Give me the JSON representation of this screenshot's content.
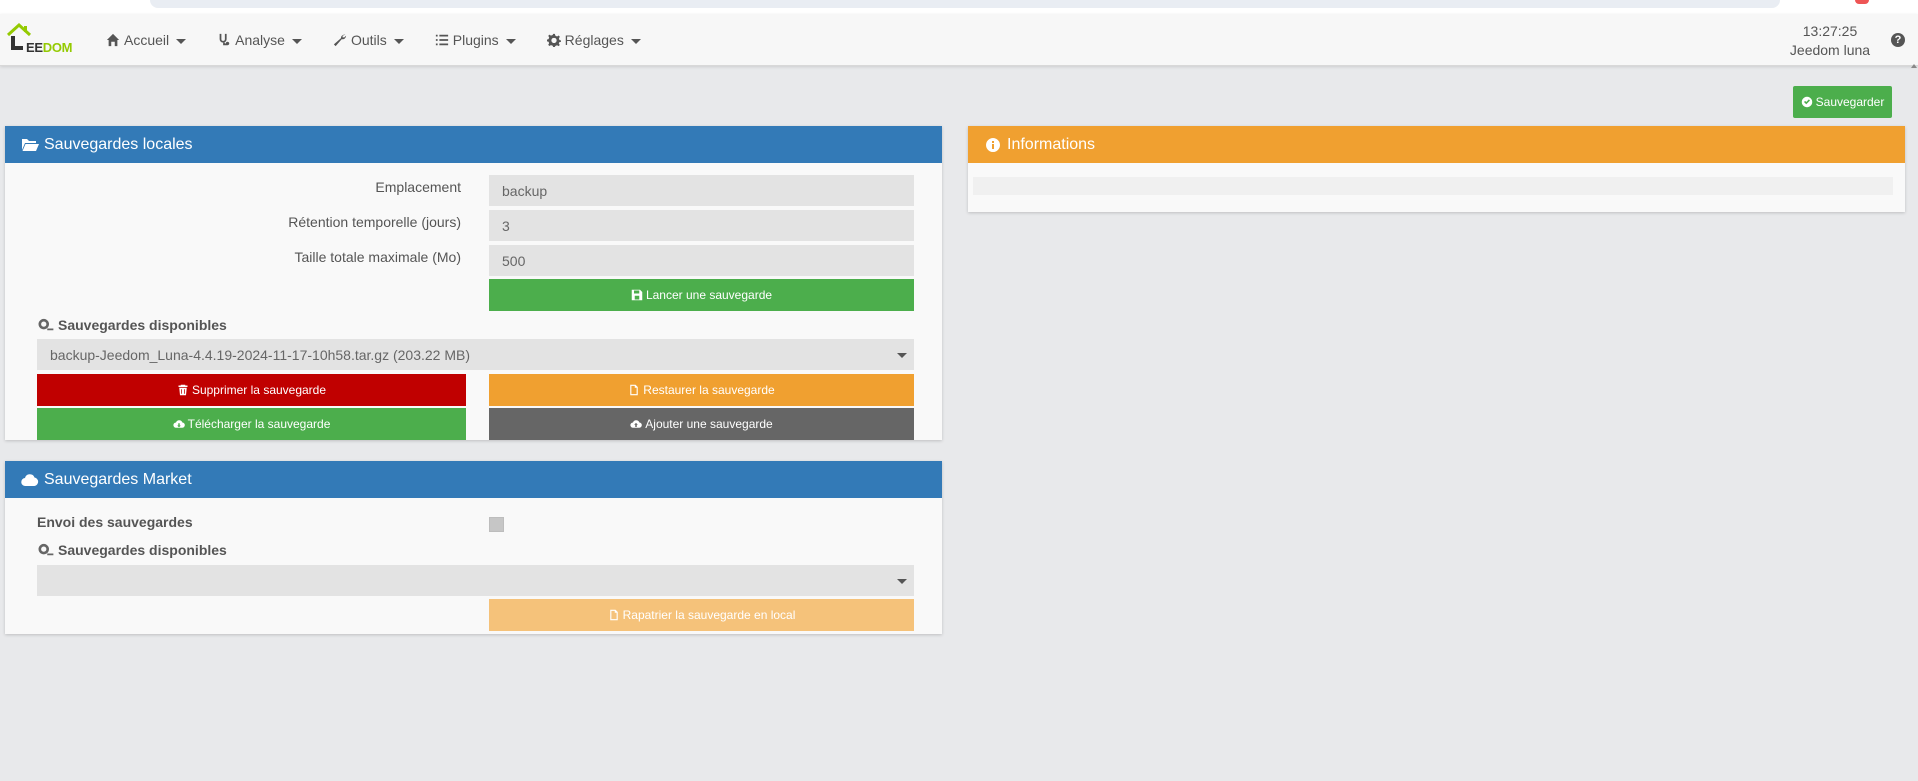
{
  "nav": {
    "logo": {
      "e": "J",
      "eedom_dark": "EE",
      "eedom_green": "DOM"
    },
    "items": [
      {
        "label": "Accueil",
        "icon": "home-icon"
      },
      {
        "label": "Analyse",
        "icon": "stethoscope-icon"
      },
      {
        "label": "Outils",
        "icon": "wrench-icon"
      },
      {
        "label": "Plugins",
        "icon": "list-icon"
      },
      {
        "label": "Réglages",
        "icon": "gear-icon"
      }
    ],
    "time": "13:27:25",
    "user": "Jeedom luna",
    "help": "?"
  },
  "toolbar": {
    "save_label": "Sauvegarder"
  },
  "local": {
    "title": "Sauvegardes locales",
    "location_label": "Emplacement",
    "location_value": "backup",
    "retention_label": "Rétention temporelle (jours)",
    "retention_value": "3",
    "max_size_label": "Taille totale maximale (Mo)",
    "max_size_value": "500",
    "launch_label": "Lancer une sauvegarde",
    "available_label": "Sauvegardes disponibles",
    "selected_backup": "backup-Jeedom_Luna-4.4.19-2024-11-17-10h58.tar.gz (203.22 MB)",
    "delete_label": "Supprimer la sauvegarde",
    "restore_label": "Restaurer la sauvegarde",
    "download_label": "Télécharger la sauvegarde",
    "add_label": "Ajouter une sauvegarde"
  },
  "market": {
    "title": "Sauvegardes Market",
    "send_label": "Envoi des sauvegardes",
    "send_checked": false,
    "available_label": "Sauvegardes disponibles",
    "selected_backup": "",
    "repatriate_label": "Rapatrier la sauvegarde en local"
  },
  "info": {
    "title": "Informations",
    "content": ""
  },
  "colors": {
    "primary": "#337ab7",
    "success": "#4cae4c",
    "danger": "#c00000",
    "warning": "#f0a030",
    "dark": "#666666",
    "brand_green": "#94ca02"
  }
}
